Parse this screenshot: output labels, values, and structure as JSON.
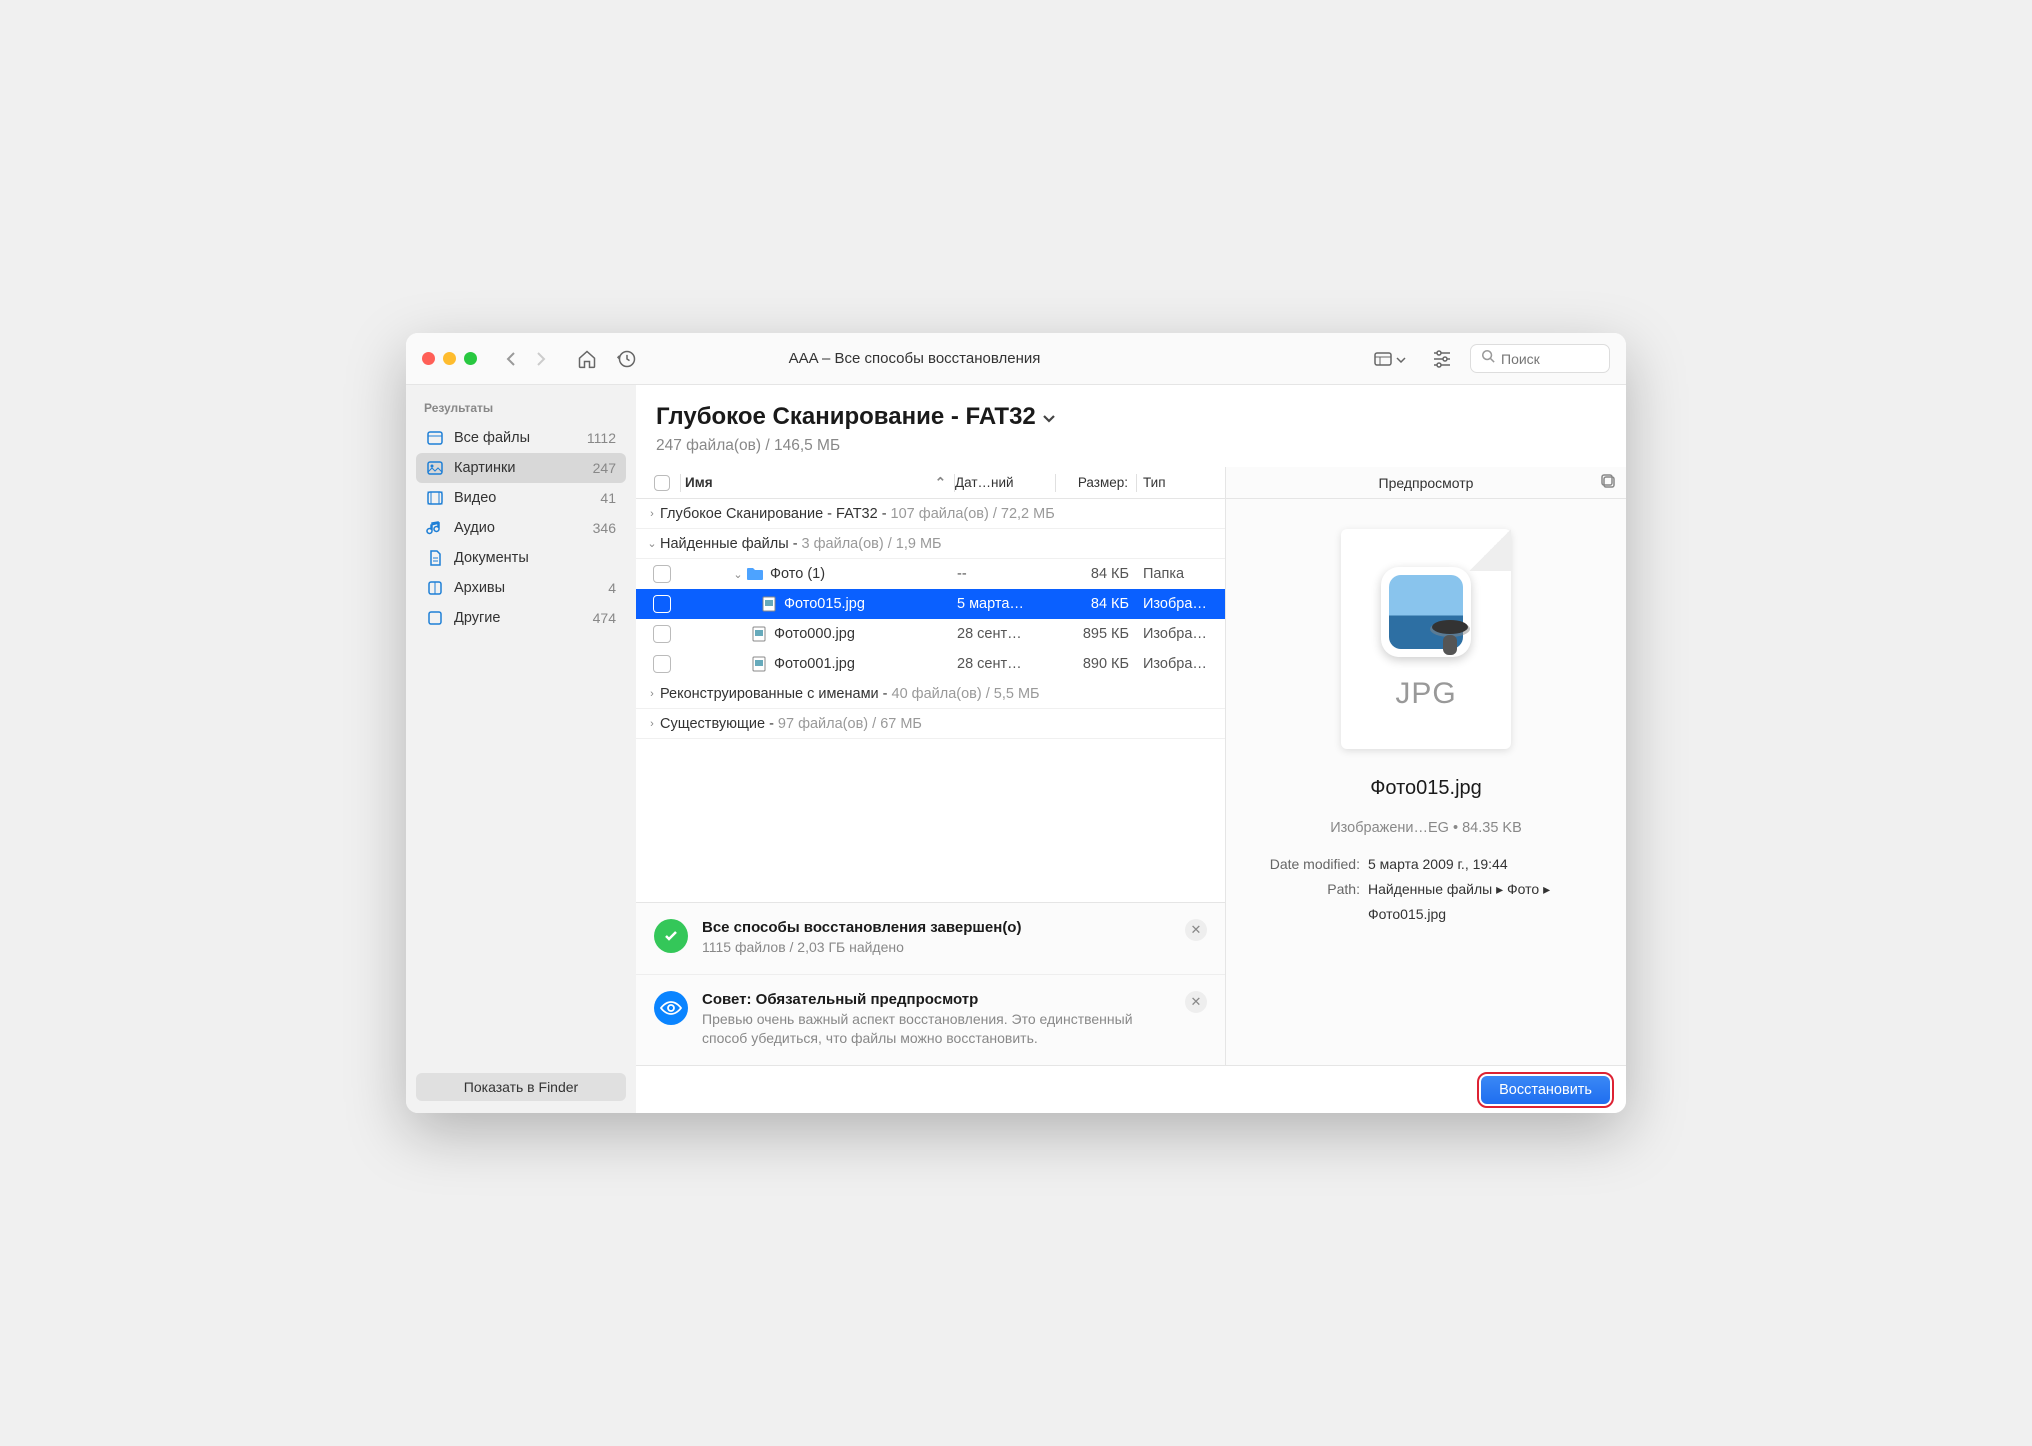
{
  "titlebar": {
    "title": "AAA – Все способы восстановления",
    "search_placeholder": "Поиск"
  },
  "sidebar": {
    "title": "Результаты",
    "items": [
      {
        "label": "Все файлы",
        "count": "1112"
      },
      {
        "label": "Картинки",
        "count": "247"
      },
      {
        "label": "Видео",
        "count": "41"
      },
      {
        "label": "Аудио",
        "count": "346"
      },
      {
        "label": "Документы",
        "count": ""
      },
      {
        "label": "Архивы",
        "count": "4"
      },
      {
        "label": "Другие",
        "count": "474"
      }
    ],
    "show_finder": "Показать в Finder"
  },
  "header": {
    "title": "Глубокое Сканирование - FAT32",
    "subtitle": "247 файла(ов) / 146,5 МБ"
  },
  "columns": {
    "name": "Имя",
    "date": "Дат…ний",
    "size": "Размер:",
    "type": "Тип"
  },
  "groups": [
    {
      "disclosure": "›",
      "name": "Глубокое Сканирование - FAT32 - ",
      "meta": "107 файла(ов) / 72,2 МБ"
    },
    {
      "disclosure": "⌄",
      "name": "Найденные файлы - ",
      "meta": "3 файла(ов) / 1,9 МБ"
    }
  ],
  "files": [
    {
      "indent": 50,
      "icon": "folder",
      "name": "Фото (1)",
      "date": "--",
      "size": "84 КБ",
      "type": "Папка",
      "selected": false,
      "disclosure": "⌄"
    },
    {
      "indent": 80,
      "icon": "image",
      "name": "Фото015.jpg",
      "date": "5 марта…",
      "size": "84 КБ",
      "type": "Изобра…",
      "selected": true
    },
    {
      "indent": 70,
      "icon": "image",
      "name": "Фото000.jpg",
      "date": "28 сент…",
      "size": "895 КБ",
      "type": "Изобра…"
    },
    {
      "indent": 70,
      "icon": "image",
      "name": "Фото001.jpg",
      "date": "28 сент…",
      "size": "890 КБ",
      "type": "Изобра…"
    }
  ],
  "groups2": [
    {
      "disclosure": "›",
      "name": "Реконструированные с именами - ",
      "meta": "40 файла(ов) / 5,5 МБ"
    },
    {
      "disclosure": "›",
      "name": "Существующие - ",
      "meta": "97 файла(ов) / 67 МБ"
    }
  ],
  "status": {
    "done_title": "Все способы восстановления завершен(о)",
    "done_text": "1115 файлов / 2,03 ГБ найдено",
    "tip_title": "Совет: Обязательный предпросмотр",
    "tip_text": "Превью очень важный аспект восстановления. Это единственный способ убедиться, что файлы можно восстановить."
  },
  "preview": {
    "header": "Предпросмотр",
    "ext": "JPG",
    "filename": "Фото015.jpg",
    "meta": "Изображени…EG • 84.35 KB",
    "date_label": "Date modified:",
    "date_value": "5 марта 2009 г., 19:44",
    "path_label": "Path:",
    "path_value": "Найденные файлы ▸ Фото ▸ Фото015.jpg"
  },
  "footer": {
    "recover": "Восстановить"
  }
}
